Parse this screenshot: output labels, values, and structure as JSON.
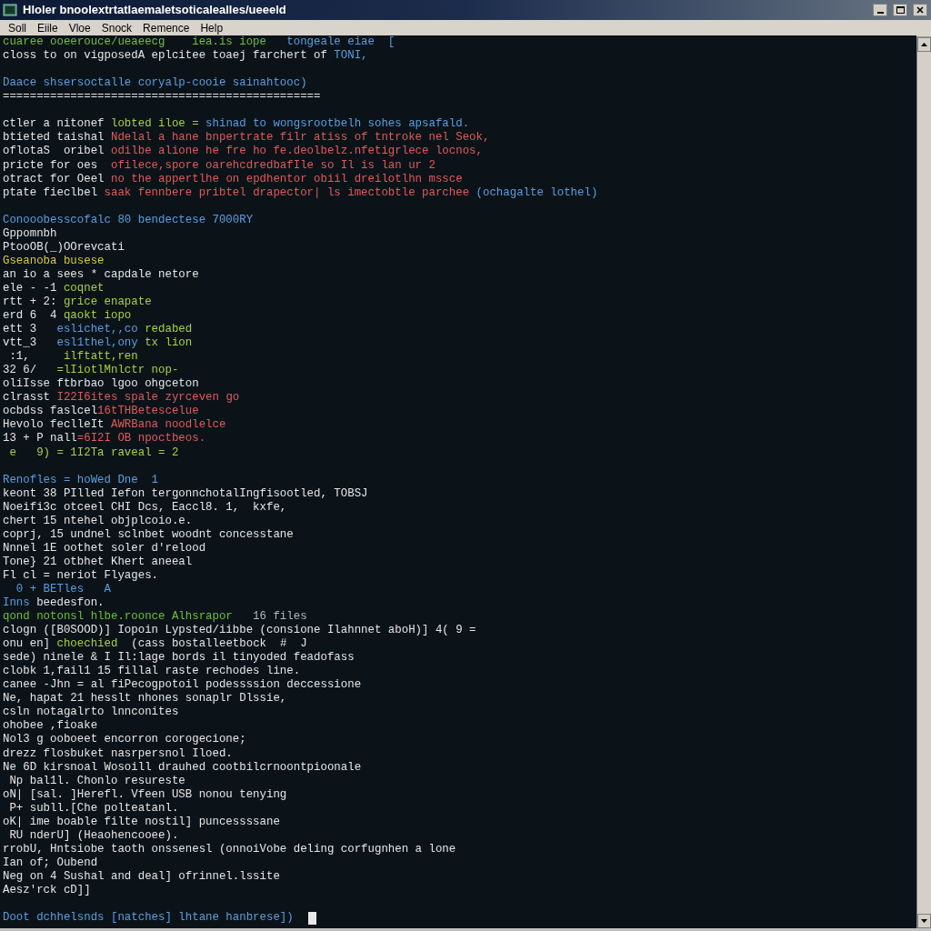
{
  "window": {
    "title": "Hloler bnoolextrtatlaemaletsoticalealles/ueeeld"
  },
  "menu": [
    "Soll",
    "Eiile",
    "Vloe",
    "Snock",
    "Remence",
    "Help"
  ],
  "terminal": {
    "blocks": [
      {
        "lines": [
          {
            "segments": [
              {
                "text": "cuaree ooeerouce/ueaeecg    iea.is iope",
                "color": "#6fbf3a"
              },
              {
                "text": "   tongeale eiae  [",
                "color": "#5b9ee0"
              }
            ]
          },
          {
            "segments": [
              {
                "text": "closs to on vigposedA eplcitee toaej farchert of ",
                "color": "#e6e6e6"
              },
              {
                "text": "TONI,",
                "color": "#5b9ee0"
              }
            ]
          }
        ]
      },
      {
        "lines": [
          {
            "segments": [
              {
                "text": "Daace shsersoctalle coryalp-cooie sainahtooc)",
                "color": "#5b9ee0"
              }
            ]
          },
          {
            "segments": [
              {
                "text": "===============================================",
                "color": "#e6e6e6"
              }
            ]
          }
        ]
      },
      {
        "lines": [
          {
            "segments": [
              {
                "text": "ctler a nitonef ",
                "color": "#e6e6e6"
              },
              {
                "text": "lobted iloe =",
                "color": "#a8d040"
              },
              {
                "text": " shinad to wongsrootbelh sohes apsafald.",
                "color": "#5b9ee0"
              }
            ]
          },
          {
            "segments": [
              {
                "text": "btieted taishal ",
                "color": "#e6e6e6"
              },
              {
                "text": "Ndelal a hane bnpertrate filr atiss of tntroke nel Seok,",
                "color": "#e05a5a"
              }
            ]
          },
          {
            "segments": [
              {
                "text": "oflotaS  oribel ",
                "color": "#e6e6e6"
              },
              {
                "text": "odilbe alione he fre ho fe.deolbelz.nfetigrlece locnos,",
                "color": "#e05a5a"
              }
            ]
          },
          {
            "segments": [
              {
                "text": "pricte for oes  ",
                "color": "#e6e6e6"
              },
              {
                "text": "ofilece,spore oarehcdredbafIle so Il is lan ur 2",
                "color": "#e05a5a"
              }
            ]
          },
          {
            "segments": [
              {
                "text": "otract for Oeel ",
                "color": "#e6e6e6"
              },
              {
                "text": "no the appertlhe on epdhentor obiil dreilotlhn mssce",
                "color": "#e05a5a"
              }
            ]
          },
          {
            "segments": [
              {
                "text": "ptate fieclbel ",
                "color": "#e6e6e6"
              },
              {
                "text": "saak fennbere pribtel drapector| ls imectobtle parchee ",
                "color": "#e05a5a"
              },
              {
                "text": "(ochagalte lothel)",
                "color": "#5b9ee0"
              }
            ]
          }
        ]
      },
      {
        "lines": [
          {
            "segments": [
              {
                "text": "Conooobesscofalc 80 bendectese 7000RY",
                "color": "#5b9ee0"
              }
            ]
          },
          {
            "segments": [
              {
                "text": "Gppomnbh",
                "color": "#e6e6e6"
              }
            ]
          },
          {
            "segments": [
              {
                "text": "PtooOB(_)OOrevcati",
                "color": "#e6e6e6"
              }
            ]
          },
          {
            "segments": [
              {
                "text": "Gseanoba busese",
                "color": "#d8c840"
              }
            ]
          },
          {
            "segments": [
              {
                "text": "an io a sees * capdale netore",
                "color": "#e6e6e6"
              }
            ]
          },
          {
            "segments": [
              {
                "text": "ele - -1 ",
                "color": "#e6e6e6"
              },
              {
                "text": "coqnet",
                "color": "#a8d040"
              }
            ]
          },
          {
            "segments": [
              {
                "text": "rtt + 2: ",
                "color": "#e6e6e6"
              },
              {
                "text": "grice enapate",
                "color": "#a8d040"
              }
            ]
          },
          {
            "segments": [
              {
                "text": "erd 6  4 ",
                "color": "#e6e6e6"
              },
              {
                "text": "qaokt iopo",
                "color": "#a8d040"
              }
            ]
          },
          {
            "segments": [
              {
                "text": "ett 3   ",
                "color": "#e6e6e6"
              },
              {
                "text": "eslichet,,co",
                "color": "#5b9ee0"
              },
              {
                "text": " redabed",
                "color": "#a8d040"
              }
            ]
          },
          {
            "segments": [
              {
                "text": "vtt_3   ",
                "color": "#e6e6e6"
              },
              {
                "text": "esl1thel,ony",
                "color": "#5b9ee0"
              },
              {
                "text": " tx lion",
                "color": "#a8d040"
              }
            ]
          },
          {
            "segments": [
              {
                "text": " :1,     ",
                "color": "#e6e6e6"
              },
              {
                "text": "ilftatt,ren",
                "color": "#a8d040"
              }
            ]
          },
          {
            "segments": [
              {
                "text": "32 6/   ",
                "color": "#e6e6e6"
              },
              {
                "text": "=lIiotlMnlctr nop-",
                "color": "#a8d040"
              }
            ]
          },
          {
            "segments": [
              {
                "text": "oliIsse ftbrbao lgoo ohgceton",
                "color": "#e6e6e6"
              }
            ]
          },
          {
            "segments": [
              {
                "text": "clrasst ",
                "color": "#e6e6e6"
              },
              {
                "text": "I22I6ites spale zyrceven go",
                "color": "#e05a5a"
              }
            ]
          },
          {
            "segments": [
              {
                "text": "ocbdss faslcel",
                "color": "#e6e6e6"
              },
              {
                "text": "16tTHBetescelue",
                "color": "#e05a5a"
              }
            ]
          },
          {
            "segments": [
              {
                "text": "Hevolo feclleIt ",
                "color": "#e6e6e6"
              },
              {
                "text": "AWRBana noodlelce",
                "color": "#e05a5a"
              }
            ]
          },
          {
            "segments": [
              {
                "text": "13 + P nall",
                "color": "#e6e6e6"
              },
              {
                "text": "=6I2I OB npoctbeos.",
                "color": "#e05a5a"
              }
            ]
          },
          {
            "segments": [
              {
                "text": " e   9) = 1I2Ta raveal = 2",
                "color": "#a8d040"
              }
            ]
          }
        ]
      },
      {
        "lines": [
          {
            "segments": [
              {
                "text": "Renofles = hoWed Dne  1",
                "color": "#5b9ee0"
              }
            ]
          },
          {
            "segments": [
              {
                "text": "keont 38 PIlled Iefon tergonnchotalIngfisootled, TOBSJ",
                "color": "#e6e6e6"
              }
            ]
          },
          {
            "segments": [
              {
                "text": "Noeifi3c otceel CHI Dcs, Eaccl8. 1,  kxfe,",
                "color": "#e6e6e6"
              }
            ]
          },
          {
            "segments": [
              {
                "text": "chert 15 ntehel objplcoio.e.",
                "color": "#e6e6e6"
              }
            ]
          },
          {
            "segments": [
              {
                "text": "coprj, 15 undnel sclnbet woodnt concesstane",
                "color": "#e6e6e6"
              }
            ]
          },
          {
            "segments": [
              {
                "text": "Nnnel 1E oothet soler d'relood",
                "color": "#e6e6e6"
              }
            ]
          },
          {
            "segments": [
              {
                "text": "Tone} 21 otbhet Khert aneeal",
                "color": "#e6e6e6"
              }
            ]
          },
          {
            "segments": [
              {
                "text": "Fl cl = neriot Flyages.",
                "color": "#e6e6e6"
              }
            ]
          },
          {
            "segments": [
              {
                "text": "  0 + BETles   A",
                "color": "#5b9ee0"
              }
            ]
          },
          {
            "segments": [
              {
                "text": "Inns",
                "color": "#5b9ee0"
              },
              {
                "text": " beedesfon.",
                "color": "#e6e6e6"
              }
            ]
          },
          {
            "segments": [
              {
                "text": "qond notonsl hlbe.roonce Alhsrapor",
                "color": "#6fbf3a"
              },
              {
                "text": "   16 files",
                "color": "#b0b8c0"
              }
            ]
          },
          {
            "segments": [
              {
                "text": "clogn ([B0SOOD)] Iopoin Lypsted/iibbe (consione Ilahnnet aboH)] 4( 9 =",
                "color": "#e6e6e6"
              }
            ]
          },
          {
            "segments": [
              {
                "text": "onu en] ",
                "color": "#e6e6e6"
              },
              {
                "text": "choechied",
                "color": "#a8d040"
              },
              {
                "text": "  (cass bostalleetbock  #  J",
                "color": "#e6e6e6"
              }
            ]
          },
          {
            "segments": [
              {
                "text": "sede) ninele & I Il:lage bords il tinyoded feadofass",
                "color": "#e6e6e6"
              }
            ]
          },
          {
            "segments": [
              {
                "text": "clobk 1,fail1 15 fillal raste rechodes line.",
                "color": "#e6e6e6"
              }
            ]
          },
          {
            "segments": [
              {
                "text": "canee -Jhn = al fiPecogpotoil podessssion deccessione",
                "color": "#e6e6e6"
              }
            ]
          },
          {
            "segments": [
              {
                "text": "Ne, hapat 21 hesslt nhones sonaplr Dlssie,",
                "color": "#e6e6e6"
              }
            ]
          },
          {
            "segments": [
              {
                "text": "csln notagalrto lnnconites",
                "color": "#e6e6e6"
              }
            ]
          },
          {
            "segments": [
              {
                "text": "ohobee ,fioake",
                "color": "#e6e6e6"
              }
            ]
          },
          {
            "segments": [
              {
                "text": "Nol3 g ooboeet encorron corogecione;",
                "color": "#e6e6e6"
              }
            ]
          },
          {
            "segments": [
              {
                "text": "drezz flosbuket nasrpersnol Iloed.",
                "color": "#e6e6e6"
              }
            ]
          },
          {
            "segments": [
              {
                "text": "Ne 6D kirsnoal Wosoill drauhed cootbilcrnoontpioonale",
                "color": "#e6e6e6"
              }
            ]
          },
          {
            "segments": [
              {
                "text": " Np bal1l. Chonlo resureste",
                "color": "#e6e6e6"
              }
            ]
          },
          {
            "segments": [
              {
                "text": "oN| [sal. ]Herefl. Vfeen USB nonou tenying",
                "color": "#e6e6e6"
              }
            ]
          },
          {
            "segments": [
              {
                "text": " P+ subll.[Che polteatanl.",
                "color": "#e6e6e6"
              }
            ]
          },
          {
            "segments": [
              {
                "text": "oK| ime boable filte nostil] puncessssane",
                "color": "#e6e6e6"
              }
            ]
          },
          {
            "segments": [
              {
                "text": " RU nderU] (Heaohencooee).",
                "color": "#e6e6e6"
              }
            ]
          },
          {
            "segments": [
              {
                "text": "rrobU, Hntsiobe taoth onssenesl (onnoiVobe deling corfugnhen a lone",
                "color": "#e6e6e6"
              }
            ]
          },
          {
            "segments": [
              {
                "text": "Ian of; Oubend",
                "color": "#e6e6e6"
              }
            ]
          },
          {
            "segments": [
              {
                "text": "Neg on 4 Sushal and deal] ofrinnel.lssite",
                "color": "#e6e6e6"
              }
            ]
          },
          {
            "segments": [
              {
                "text": "Aesz'rck cD]]",
                "color": "#e6e6e6"
              }
            ]
          }
        ]
      },
      {
        "lines": [
          {
            "segments": [
              {
                "text": "Doot dchhelsnds [natches] lhtane hanbrese])",
                "color": "#5b9ee0"
              }
            ],
            "cursor": true
          }
        ]
      }
    ]
  }
}
